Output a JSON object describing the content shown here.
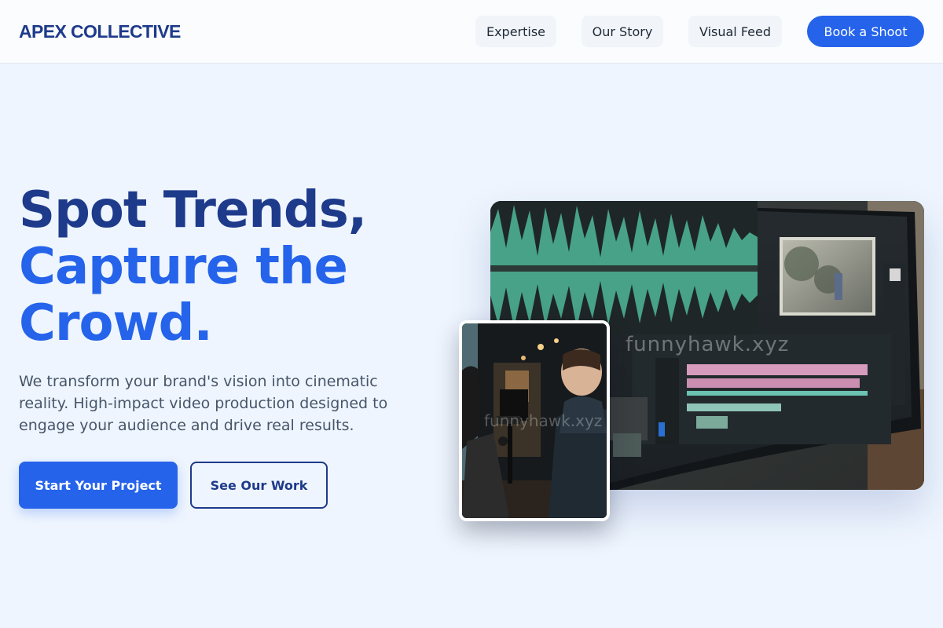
{
  "header": {
    "logo": "APEX COLLECTIVE",
    "nav": [
      {
        "label": "Expertise"
      },
      {
        "label": "Our Story"
      },
      {
        "label": "Visual Feed"
      }
    ],
    "cta_label": "Book a Shoot"
  },
  "hero": {
    "headline_line1": "Spot Trends,",
    "headline_line2": "Capture the",
    "headline_line3": "Crowd.",
    "subtitle": "We transform your brand's vision into cinematic reality. High-impact video production designed to engage your audience and drive real results.",
    "primary_button": "Start Your Project",
    "secondary_button": "See Our Work"
  },
  "images": {
    "main_watermark": "funnyhawk.xyz",
    "inset_watermark": "funnyhawk.xyz"
  },
  "colors": {
    "brand_dark": "#1e3a8a",
    "brand_accent": "#2563eb",
    "page_background": "#eef5fe",
    "header_background": "#fafcfe",
    "body_text": "#475569"
  }
}
